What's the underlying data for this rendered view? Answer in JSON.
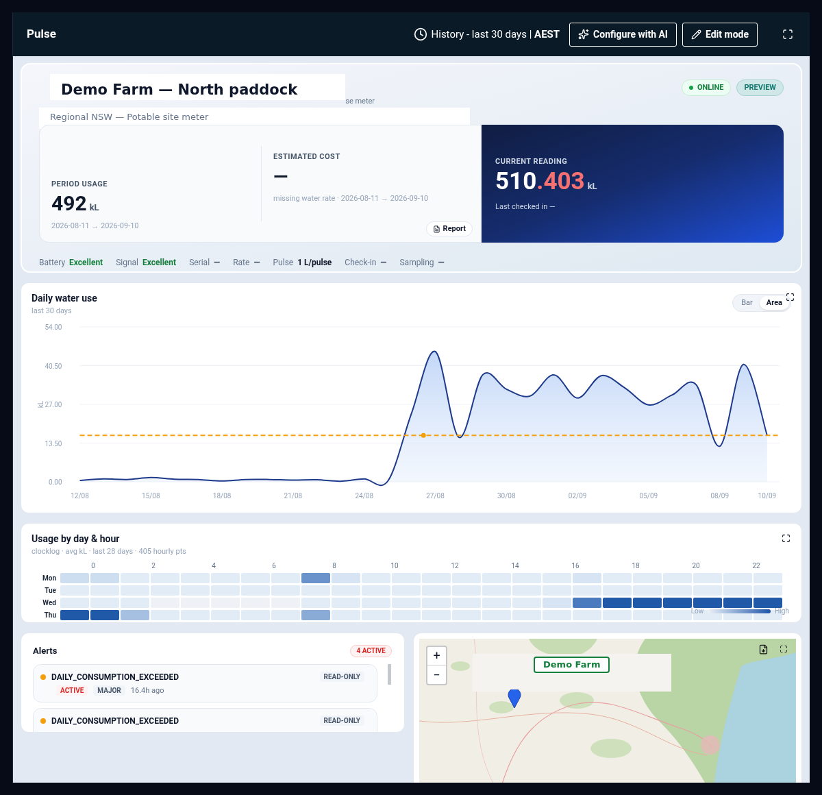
{
  "header": {
    "title": "Pulse",
    "history": "History - last 30 days | ",
    "timezone": "AEST",
    "buttons": [
      "Configure with AI",
      "Edit mode"
    ]
  },
  "site": {
    "title": "Demo Farm — North paddock",
    "subtitle": "Regional NSW — Potable site meter",
    "fragment": "se meter",
    "badges": [
      {
        "label": "ONLINE",
        "kind": "status"
      },
      {
        "label": "PREVIEW",
        "kind": "plain"
      }
    ]
  },
  "stats": {
    "usage": {
      "label": "PERIOD USAGE",
      "value": "492",
      "unit": "kL",
      "range": "2026-08-11 → 2026-09-10"
    },
    "cost": {
      "label": "ESTIMATED COST",
      "value": "—",
      "note": "missing water rate · 2026-08-11 → 2026-09-10"
    },
    "report": "Report",
    "reading": {
      "label": "CURRENT READING",
      "whole": "510",
      "fraction": ".403",
      "unit": "kL",
      "note": "Last checked in —"
    }
  },
  "facts": [
    {
      "label": "Battery",
      "value": "Excellent",
      "kind": "good"
    },
    {
      "label": "Signal",
      "value": "Excellent",
      "kind": "good"
    },
    {
      "label": "Serial",
      "value": "—",
      "kind": "none"
    },
    {
      "label": "Rate",
      "value": "—",
      "kind": "none"
    },
    {
      "label": "Pulse",
      "value": "1 L/pulse",
      "kind": "set"
    },
    {
      "label": "Check-in",
      "value": "—",
      "kind": "none"
    },
    {
      "label": "Sampling",
      "value": "—",
      "kind": "none"
    }
  ],
  "daily": {
    "title": "Daily water use",
    "subtitle": "last 30 days",
    "modes": [
      {
        "label": "Bar",
        "selected": false
      },
      {
        "label": "Area",
        "selected": true
      }
    ],
    "chart_data": {
      "type": "area",
      "ylabel": "kL",
      "grid": true,
      "categories": [
        "12/08",
        null,
        null,
        "15/08",
        null,
        null,
        "18/08",
        null,
        null,
        "21/08",
        null,
        null,
        "24/08",
        null,
        null,
        "27/08",
        null,
        null,
        "30/08",
        null,
        null,
        "02/09",
        null,
        null,
        "05/09",
        null,
        null,
        "08/09",
        null,
        "10/09"
      ],
      "series": [
        {
          "color": "#1e3a8a",
          "values": [
            0.5,
            1,
            0.8,
            1.5,
            0.9,
            0.8,
            0.3,
            0.8,
            0.8,
            0.6,
            0.7,
            0.2,
            1,
            0.3,
            24,
            45.4,
            15.5,
            37.3,
            32.3,
            29.9,
            37.3,
            29.2,
            37,
            32.7,
            26.8,
            30.3,
            33.9,
            12.4,
            40.9,
            16.2
          ]
        }
      ],
      "ylim": [
        0,
        54
      ],
      "yticks": [
        {
          "value": 0,
          "label": "0.00"
        },
        {
          "value": 13.5,
          "label": "13.50"
        },
        {
          "value": 27,
          "label": "27.00"
        },
        {
          "value": 40.5,
          "label": "40.50"
        },
        {
          "value": 54,
          "label": "54.00"
        }
      ],
      "ref_lines": [
        {
          "axis": "y",
          "value": 16.2,
          "color": "#f59e0b"
        }
      ]
    }
  },
  "heatmap": {
    "title": "Usage by day & hour",
    "subtitle": "clocklog · avg kL · last 28 days · 405 hourly pts",
    "hours": [
      "0",
      "2",
      "4",
      "6",
      "8",
      "10",
      "12",
      "14",
      "16",
      "18",
      "20",
      "22"
    ],
    "legend": [
      "Low",
      "High"
    ],
    "rows": [
      {
        "day": "Mon",
        "cells": [
          {
            "color": "#cddef0"
          },
          {
            "color": "#cddef0"
          },
          {
            "color": "#e1ecf7"
          },
          {
            "color": "#e1ecf7"
          },
          {
            "color": "#e1ecf7"
          },
          {
            "color": "#e1ecf7"
          },
          {
            "color": "#e1ecf7"
          },
          {
            "color": "#e1ecf7"
          },
          {
            "color": "#6a93cb"
          },
          {
            "color": "#d6e4f3"
          },
          {
            "color": "#e1ecf7"
          },
          {
            "color": "#e1ecf7"
          },
          {
            "color": "#e1ecf7"
          },
          {
            "color": "#e1ecf7"
          },
          {
            "color": "#e1ecf7"
          },
          {
            "color": "#e1ecf7"
          },
          {
            "color": "#e1ecf7"
          },
          {
            "color": "#d6e4f3"
          },
          {
            "color": "#e1ecf7"
          },
          {
            "color": "#e1ecf7"
          },
          {
            "color": "#e1ecf7"
          },
          {
            "color": "#e1ecf7"
          },
          {
            "color": "#e1ecf7"
          },
          {
            "color": "#e1ecf7"
          }
        ]
      },
      {
        "day": "Tue",
        "cells": [
          {
            "color": "#e1ecf7"
          },
          {
            "color": "#e1ecf7"
          },
          {
            "color": "#e1ecf7"
          },
          {
            "color": "#e1ecf7"
          },
          {
            "color": "#e1ecf7"
          },
          {
            "color": "#e1ecf7"
          },
          {
            "color": "#e1ecf7"
          },
          {
            "color": "#e1ecf7"
          },
          {
            "color": "#e1ecf7"
          },
          {
            "color": "#e1ecf7"
          },
          {
            "color": "#e1ecf7"
          },
          {
            "color": "#e1ecf7"
          },
          {
            "color": "#e1ecf7"
          },
          {
            "color": "#e1ecf7"
          },
          {
            "color": "#e1ecf7"
          },
          {
            "color": "#e1ecf7"
          },
          {
            "color": "#e1ecf7"
          },
          {
            "color": "#e1ecf7"
          },
          {
            "color": "#e1ecf7"
          },
          {
            "color": "#e1ecf7"
          },
          {
            "color": "#e1ecf7"
          },
          {
            "color": "#e1ecf7"
          },
          {
            "color": "#e1ecf7"
          },
          {
            "color": "#e1ecf7"
          }
        ]
      },
      {
        "day": "Wed",
        "cells": [
          {
            "color": "#e1ecf7"
          },
          {
            "color": "#e1ecf7"
          },
          {
            "color": "#e1ecf7"
          },
          {
            "color": "#eef1f5"
          },
          {
            "color": "#eef1f5"
          },
          {
            "color": "#eef1f5"
          },
          {
            "color": "#eef1f5"
          },
          {
            "color": "#eef1f5"
          },
          {
            "color": "#e1ecf7"
          },
          {
            "color": "#e1ecf7"
          },
          {
            "color": "#e1ecf7"
          },
          {
            "color": "#e1ecf7"
          },
          {
            "color": "#e1ecf7"
          },
          {
            "color": "#e1ecf7"
          },
          {
            "color": "#e1ecf7"
          },
          {
            "color": "#e1ecf7"
          },
          {
            "color": "#d6e4f3"
          },
          {
            "color": "#4a7bbf"
          },
          {
            "color": "#2059a8"
          },
          {
            "color": "#2059a8"
          },
          {
            "color": "#2059a8"
          },
          {
            "color": "#2059a8"
          },
          {
            "color": "#2059a8"
          },
          {
            "color": "#2059a8"
          }
        ]
      },
      {
        "day": "Thu",
        "cells": [
          {
            "color": "#2059a8"
          },
          {
            "color": "#2059a8"
          },
          {
            "color": "#a5c0e0"
          },
          {
            "color": "#e1ecf7"
          },
          {
            "color": "#e1ecf7"
          },
          {
            "color": "#e1ecf7"
          },
          {
            "color": "#e1ecf7"
          },
          {
            "color": "#e1ecf7"
          },
          {
            "color": "#8aabd6"
          },
          {
            "color": "#e1ecf7"
          },
          {
            "color": "#e1ecf7"
          },
          {
            "color": "#e1ecf7"
          },
          {
            "color": "#e1ecf7"
          },
          {
            "color": "#e1ecf7"
          },
          {
            "color": "#e1ecf7"
          },
          {
            "color": "#e1ecf7"
          },
          {
            "color": "#e1ecf7"
          },
          {
            "color": "#e1ecf7"
          },
          {
            "color": "#e1ecf7"
          },
          {
            "color": "#e1ecf7"
          },
          {
            "color": "#e1ecf7"
          },
          {
            "color": "#e1ecf7"
          },
          {
            "color": "#e1ecf7"
          },
          {
            "color": "#e1ecf7"
          }
        ]
      }
    ]
  },
  "alerts": {
    "title": "Alerts",
    "count": "4 ACTIVE",
    "items": [
      {
        "name": "DAILY_CONSUMPTION_EXCEEDED",
        "access": "READ-ONLY",
        "status": "ACTIVE",
        "severity": "MAJOR",
        "age": "16.4h ago"
      },
      {
        "name": "DAILY_CONSUMPTION_EXCEEDED",
        "access": "READ-ONLY"
      }
    ]
  },
  "map": {
    "zoom": [
      "+",
      "−"
    ],
    "label": "Demo Farm"
  }
}
